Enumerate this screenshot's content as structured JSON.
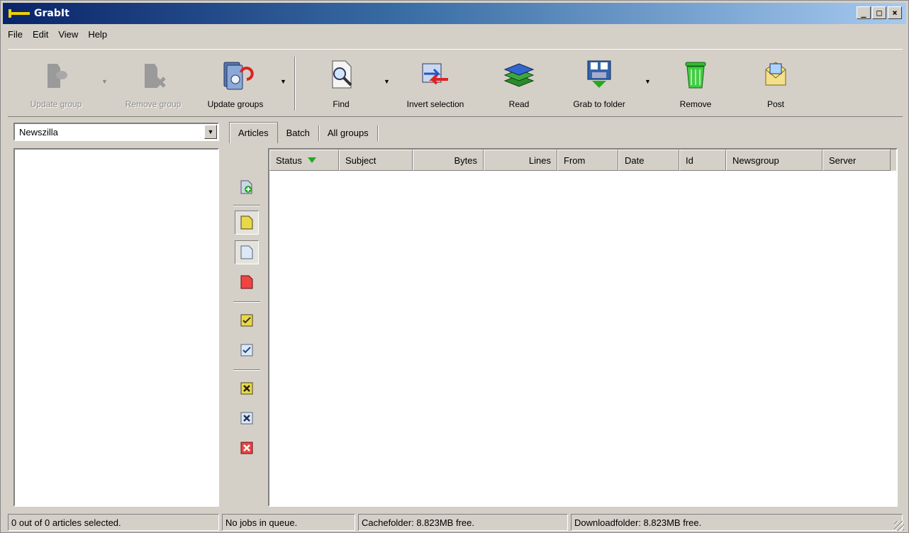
{
  "window": {
    "title": "GrabIt"
  },
  "window_buttons": {
    "minimize": "_",
    "maximize": "□",
    "close": "×"
  },
  "menu": [
    "File",
    "Edit",
    "View",
    "Help"
  ],
  "toolbar": {
    "update_group": "Update group",
    "remove_group": "Remove group",
    "update_groups": "Update groups",
    "find": "Find",
    "invert_selection": "Invert selection",
    "read": "Read",
    "grab_to_folder": "Grab to folder",
    "remove": "Remove",
    "post": "Post",
    "dropdown_arrow": "▼"
  },
  "server_select": {
    "value": "Newszilla",
    "arrow": "▼"
  },
  "tabs": [
    "Articles",
    "Batch",
    "All groups"
  ],
  "columns": [
    "Status",
    "Subject",
    "Bytes",
    "Lines",
    "From",
    "Date",
    "Id",
    "Newsgroup",
    "Server"
  ],
  "status": {
    "selection": "0 out of 0 articles selected.",
    "queue": "No jobs in queue.",
    "cache": "Cachefolder: 8.823MB free.",
    "download": "Downloadfolder: 8.823MB free."
  },
  "colors": {
    "title_gradient_start": "#0a246a",
    "title_gradient_end": "#a6caf0",
    "chrome": "#d4d0c8",
    "sort_arrow": "#22aa22"
  }
}
